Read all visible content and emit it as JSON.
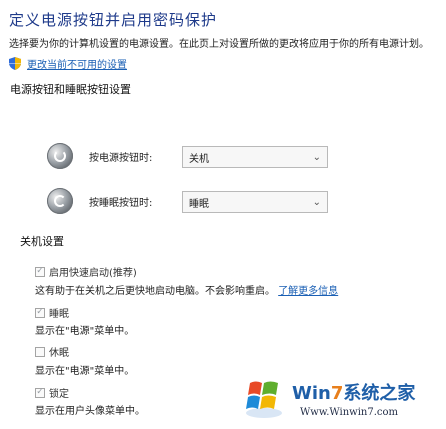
{
  "header": {
    "title": "定义电源按钮并启用密码保护",
    "description": "选择要为你的计算机设置的电源设置。在此页上对设置所做的更改将应用于你的所有电源计划。"
  },
  "shield_link": {
    "label": "更改当前不可用的设置",
    "icon": "shield-icon"
  },
  "power_buttons": {
    "heading": "电源按钮和睡眠按钮设置",
    "rows": [
      {
        "label": "按电源按钮时:",
        "value": "关机",
        "icon": "power-button-icon"
      },
      {
        "label": "按睡眠按钮时:",
        "value": "睡眠",
        "icon": "sleep-button-icon"
      }
    ]
  },
  "shutdown_settings": {
    "heading": "关机设置",
    "items": [
      {
        "label": "启用快速启动(推荐)",
        "checked": true,
        "desc": "这有助于在关机之后更快地启动电脑。不会影响重启。",
        "link": "了解更多信息"
      },
      {
        "label": "睡眠",
        "checked": true,
        "desc": "显示在\"电源\"菜单中。"
      },
      {
        "label": "休眠",
        "checked": false,
        "desc": "显示在\"电源\"菜单中。"
      },
      {
        "label": "锁定",
        "checked": true,
        "desc": "显示在用户头像菜单中。"
      }
    ]
  },
  "watermark": {
    "brand_prefix": "Win",
    "brand_seven": "7",
    "brand_suffix": "系统之家",
    "url": "Www.Winwin7.com"
  },
  "colors": {
    "title": "#1e3a8a",
    "link": "#1a5fb4",
    "logo_blue": "#1f5fa8",
    "logo_orange": "#e87f1c"
  }
}
